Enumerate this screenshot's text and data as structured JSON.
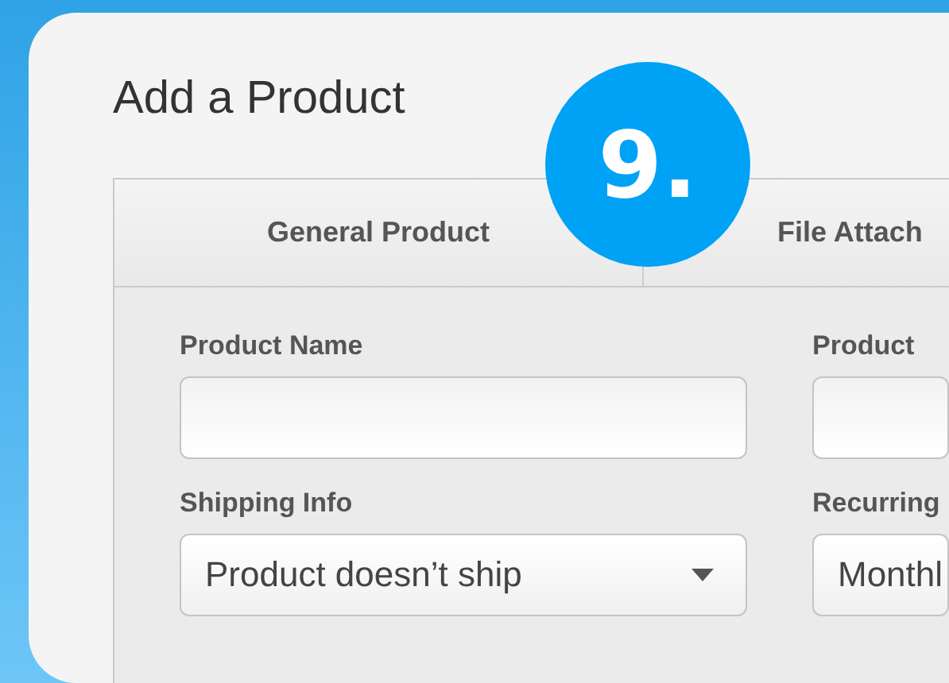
{
  "dialog": {
    "title": "Add a Product"
  },
  "badge": "9.",
  "tabs": [
    {
      "label": "General Product"
    },
    {
      "label": "File Attach"
    }
  ],
  "fields": [
    {
      "kind": "text",
      "label": "Product Name"
    },
    {
      "kind": "text",
      "label": "Product"
    },
    {
      "kind": "select",
      "label": "Shipping Info",
      "value": "Product doesn’t ship"
    },
    {
      "kind": "select",
      "label": "Recurring",
      "value": "Monthl"
    }
  ]
}
